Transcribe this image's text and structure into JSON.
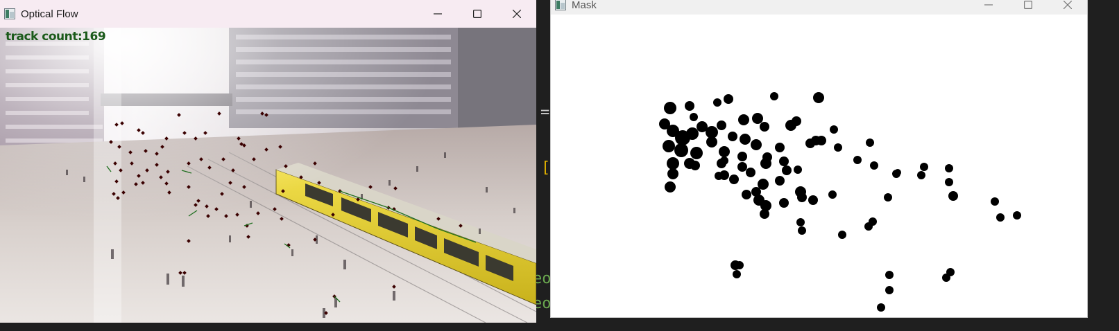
{
  "optical_window": {
    "title": "Optical Flow",
    "overlay_text": "track count:169",
    "controls": [
      "minimize-icon",
      "maximize-icon",
      "close-icon"
    ]
  },
  "mask_window": {
    "title": "Mask",
    "controls": [
      "minimize-icon",
      "maximize-icon",
      "close-icon"
    ]
  },
  "background": {
    "snippet_1": "=",
    "snippet_2": "[",
    "snippet_3": "eo",
    "snippet_4": "eo"
  },
  "colors": {
    "optical_titlebar": "#f7ebf2",
    "mask_titlebar": "#f0f0f0",
    "overlay_text": "#1a5a1a",
    "track_point": "#3a0000",
    "flow_line": "#1f6f1f",
    "mask_blob": "#000000",
    "tram": "#e8d23a"
  }
}
